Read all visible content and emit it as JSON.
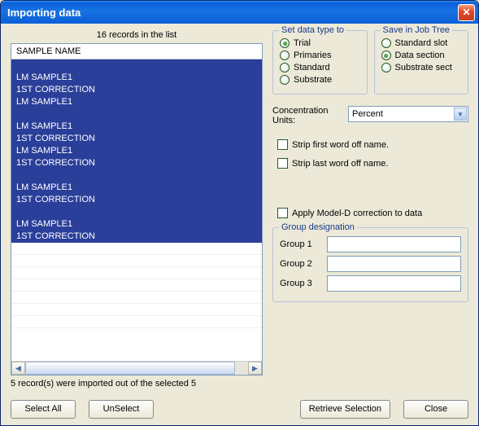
{
  "window": {
    "title": "Importing data"
  },
  "list": {
    "caption": "16 records in the list",
    "header": "SAMPLE NAME",
    "rows": [
      {
        "text": "",
        "selected": true
      },
      {
        "text": "LM SAMPLE1",
        "selected": true
      },
      {
        "text": "1ST CORRECTION",
        "selected": true
      },
      {
        "text": "LM SAMPLE1",
        "selected": true
      },
      {
        "text": "",
        "selected": true
      },
      {
        "text": "LM SAMPLE1",
        "selected": true
      },
      {
        "text": "1ST CORRECTION",
        "selected": true
      },
      {
        "text": "LM SAMPLE1",
        "selected": true
      },
      {
        "text": "1ST CORRECTION",
        "selected": true
      },
      {
        "text": "",
        "selected": true
      },
      {
        "text": "LM SAMPLE1",
        "selected": true
      },
      {
        "text": "1ST CORRECTION",
        "selected": true
      },
      {
        "text": "",
        "selected": true
      },
      {
        "text": "LM SAMPLE1",
        "selected": true
      },
      {
        "text": "1ST CORRECTION",
        "selected": true
      },
      {
        "text": "",
        "selected": false
      },
      {
        "text": "",
        "selected": false
      },
      {
        "text": "",
        "selected": false
      },
      {
        "text": "",
        "selected": false
      },
      {
        "text": "",
        "selected": false
      },
      {
        "text": "",
        "selected": false
      },
      {
        "text": "",
        "selected": false
      }
    ],
    "status": "5 record(s) were imported out of the selected 5"
  },
  "data_type": {
    "legend": "Set data type to",
    "options": [
      "Trial",
      "Primaries",
      "Standard",
      "Substrate"
    ],
    "selected": "Trial"
  },
  "save_in": {
    "legend": "Save in Job Tree",
    "options": [
      "Standard slot",
      "Data section",
      "Substrate sect"
    ],
    "selected": "Data section"
  },
  "concentration": {
    "label": "Concentration Units:",
    "value": "Percent"
  },
  "strip_first": {
    "label": "Strip first word off name.",
    "checked": false
  },
  "strip_last": {
    "label": "Strip last word off name.",
    "checked": false
  },
  "apply_modeld": {
    "label": "Apply Model-D correction to data",
    "checked": false
  },
  "groups": {
    "legend": "Group designation",
    "items": [
      {
        "label": "Group 1",
        "value": ""
      },
      {
        "label": "Group 2",
        "value": ""
      },
      {
        "label": "Group 3",
        "value": ""
      }
    ]
  },
  "buttons": {
    "select_all": "Select All",
    "unselect": "UnSelect",
    "retrieve": "Retrieve Selection",
    "close": "Close"
  }
}
